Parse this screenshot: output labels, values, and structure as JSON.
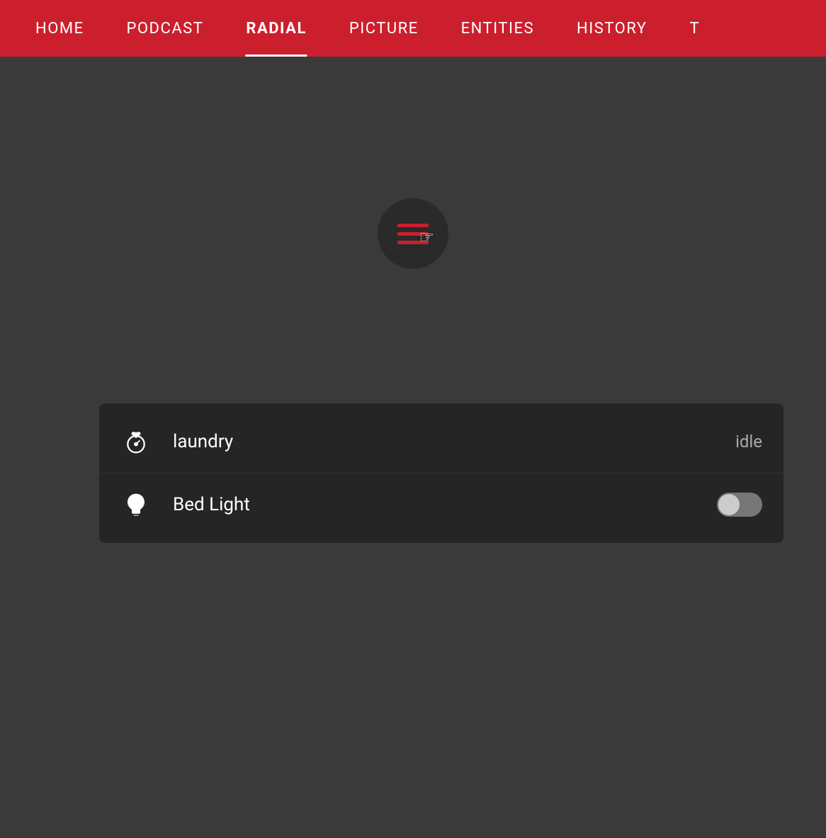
{
  "navbar": {
    "items": [
      {
        "id": "home",
        "label": "HOME",
        "active": false
      },
      {
        "id": "podcast",
        "label": "PODCAST",
        "active": false
      },
      {
        "id": "radial",
        "label": "RADIAL",
        "active": true
      },
      {
        "id": "picture",
        "label": "PICTURE",
        "active": false
      },
      {
        "id": "entities",
        "label": "ENTITIES",
        "active": false
      },
      {
        "id": "history",
        "label": "HISTORY",
        "active": false
      },
      {
        "id": "t",
        "label": "T",
        "active": false
      }
    ]
  },
  "radial_button": {
    "aria_label": "Radial Menu"
  },
  "panel": {
    "rows": [
      {
        "id": "laundry",
        "label": "laundry",
        "icon": "stopwatch",
        "status": "idle",
        "toggle": null
      },
      {
        "id": "bed-light",
        "label": "Bed Light",
        "icon": "bulb",
        "status": null,
        "toggle": {
          "on": false
        }
      }
    ]
  },
  "colors": {
    "accent": "#cc1f2d",
    "background": "#3a3a3a",
    "panel_bg": "#252525",
    "nav_bg": "#cc1f2d",
    "text_primary": "#ffffff",
    "text_secondary": "#aaaaaa"
  }
}
